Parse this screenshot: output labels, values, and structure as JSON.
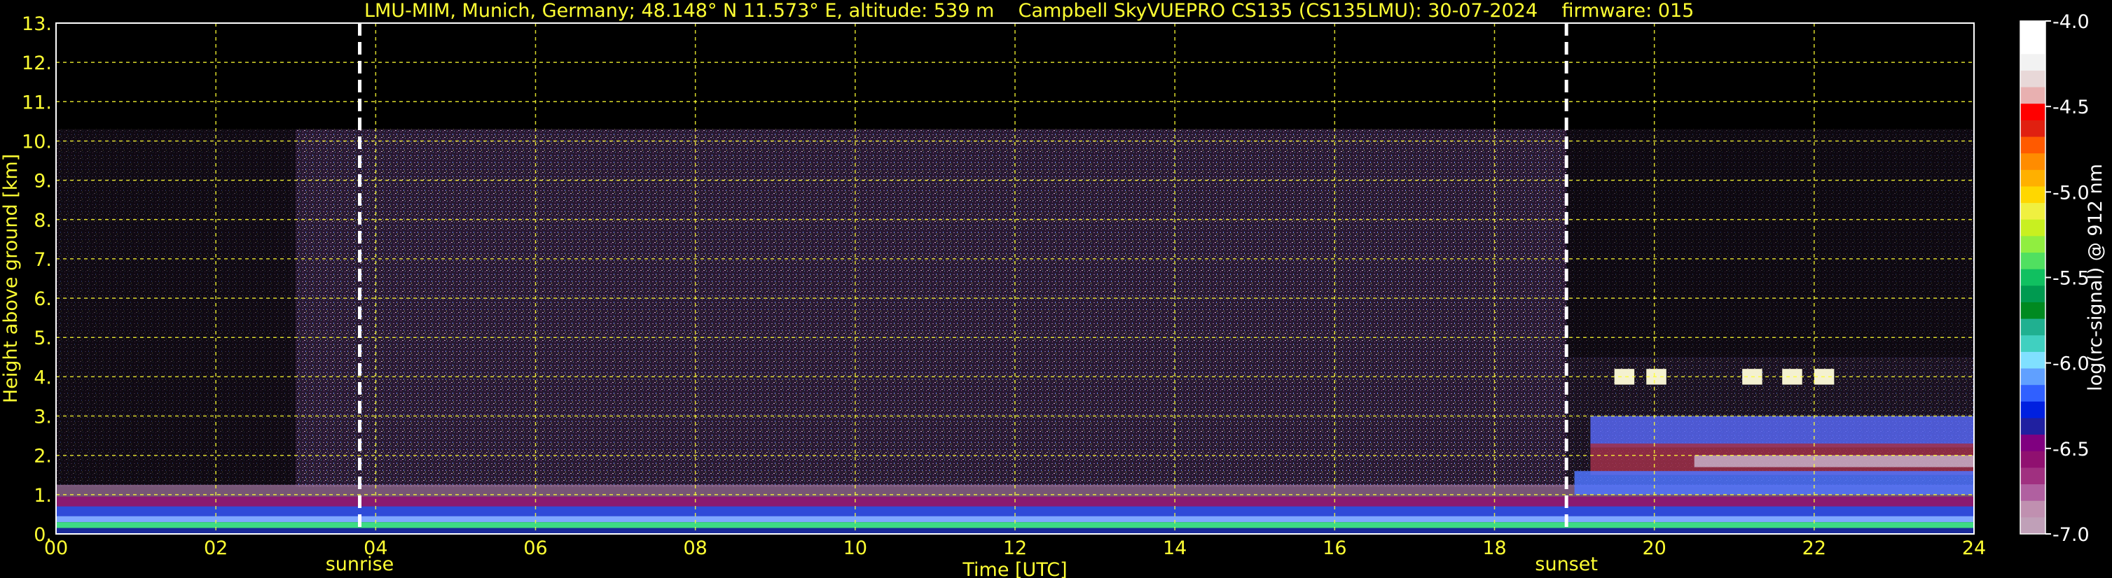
{
  "chart_data": {
    "type": "heatmap",
    "title": "LMU-MIM, Munich, Germany; 48.148° N 11.573° E, altitude: 539 m    Campbell SkyVUEPRO CS135 (CS135LMU): 30-07-2024    firmware: 015",
    "xlabel": "Time [UTC]",
    "ylabel": "Height above ground [km]",
    "xlim": [
      0,
      24
    ],
    "ylim": [
      0,
      13
    ],
    "x_ticks": [
      "00",
      "02",
      "04",
      "06",
      "08",
      "10",
      "12",
      "14",
      "16",
      "18",
      "20",
      "22",
      "24"
    ],
    "y_ticks": [
      "0.",
      "1.",
      "2.",
      "3.",
      "4.",
      "5.",
      "6.",
      "7.",
      "8.",
      "9.",
      "10.",
      "11.",
      "12.",
      "13."
    ],
    "grid": true,
    "events": [
      {
        "label": "sunrise",
        "time": 3.8
      },
      {
        "label": "sunset",
        "time": 18.9
      }
    ],
    "colorbar": {
      "label": "log(rc-signal) @ 912 nm",
      "range": [
        -7.0,
        -4.0
      ],
      "ticks": [
        "-4.0",
        "-4.5",
        "-5.0",
        "-5.5",
        "-6.0",
        "-6.5",
        "-7.0"
      ],
      "colors": [
        "#ffffff",
        "#ffffff",
        "#f2f2f2",
        "#e8d8d8",
        "#e8b0b0",
        "#ff0000",
        "#e02010",
        "#ff5a00",
        "#ff8c00",
        "#ffb000",
        "#ffd700",
        "#f0f040",
        "#c8f020",
        "#90ee40",
        "#50e060",
        "#10c060",
        "#009a50",
        "#008a20",
        "#20b090",
        "#40d0c0",
        "#80e0ff",
        "#60a0ff",
        "#3060ff",
        "#0020e0",
        "#2020a0",
        "#800080",
        "#901070",
        "#a03080",
        "#b060a0",
        "#c090b0",
        "#c0a0b8"
      ]
    },
    "data_summary": {
      "signal_top_km": 10.3,
      "surface_layer_top_km": 1.0,
      "evening_layers_km": [
        1.5,
        2.2,
        3.0
      ],
      "cloud_patches_km": 4.0,
      "cloud_patch_times": [
        19.5,
        19.9,
        21.1,
        21.6,
        22.0
      ]
    }
  }
}
